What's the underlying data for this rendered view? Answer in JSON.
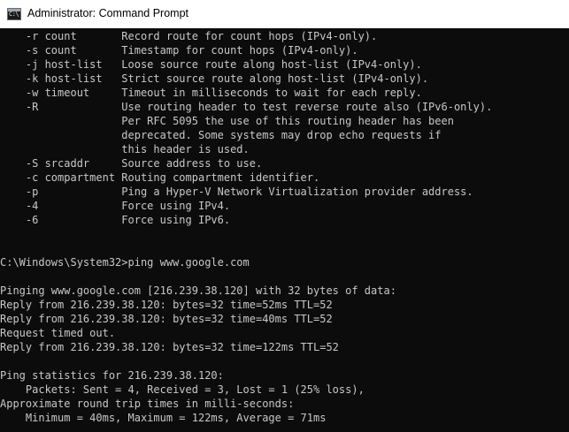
{
  "window": {
    "title": "Administrator: Command Prompt",
    "icon": "cmd-icon",
    "icon_glyph": "C:\\"
  },
  "console": {
    "text_color": "#c8c8c8",
    "background": "#0c0c0c",
    "lines": [
      "    -r count       Record route for count hops (IPv4-only).",
      "    -s count       Timestamp for count hops (IPv4-only).",
      "    -j host-list   Loose source route along host-list (IPv4-only).",
      "    -k host-list   Strict source route along host-list (IPv4-only).",
      "    -w timeout     Timeout in milliseconds to wait for each reply.",
      "    -R             Use routing header to test reverse route also (IPv6-only).",
      "                   Per RFC 5095 the use of this routing header has been",
      "                   deprecated. Some systems may drop echo requests if",
      "                   this header is used.",
      "    -S srcaddr     Source address to use.",
      "    -c compartment Routing compartment identifier.",
      "    -p             Ping a Hyper-V Network Virtualization provider address.",
      "    -4             Force using IPv4.",
      "    -6             Force using IPv6.",
      "",
      "",
      "C:\\Windows\\System32>ping www.google.com",
      "",
      "Pinging www.google.com [216.239.38.120] with 32 bytes of data:",
      "Reply from 216.239.38.120: bytes=32 time=52ms TTL=52",
      "Reply from 216.239.38.120: bytes=32 time=40ms TTL=52",
      "Request timed out.",
      "Reply from 216.239.38.120: bytes=32 time=122ms TTL=52",
      "",
      "Ping statistics for 216.239.38.120:",
      "    Packets: Sent = 4, Received = 3, Lost = 1 (25% loss),",
      "Approximate round trip times in milli-seconds:",
      "    Minimum = 40ms, Maximum = 122ms, Average = 71ms"
    ]
  }
}
